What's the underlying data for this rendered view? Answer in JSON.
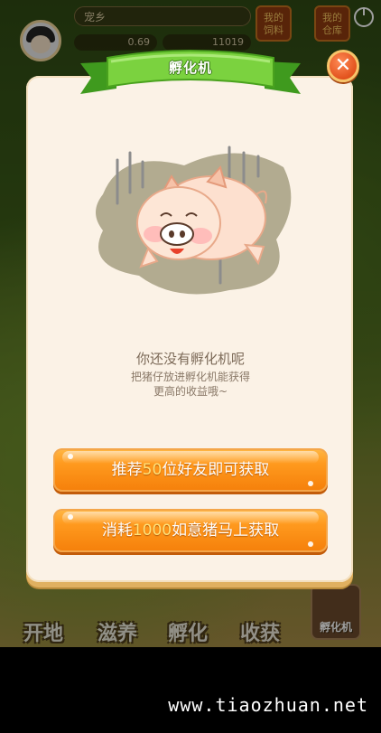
{
  "hud": {
    "name": "宠乡",
    "stat_1": "0.69",
    "stat_2": "11019",
    "button_1": "我的\n饲料",
    "button_2": "我的\n仓库"
  },
  "dialog": {
    "title": "孵化机",
    "close_icon": "close-x-icon",
    "message": "你还没有孵化机呢",
    "sub_line_1": "把猪仔放进孵化机能获得",
    "sub_line_2": "更高的收益哦~",
    "button_1": {
      "prefix": "推荐",
      "highlight": "50",
      "suffix": "位好友即可获取"
    },
    "button_2": {
      "prefix": "消耗",
      "highlight": "1000",
      "suffix": "如意猪马上获取"
    }
  },
  "bottom_bar": {
    "items": [
      "开地",
      "滋养",
      "孵化",
      "收获"
    ],
    "incubator_label": "孵化机"
  },
  "footer": {
    "watermark": "www.tiaozhuan.net"
  },
  "colors": {
    "accent_orange": "#f57f0a",
    "highlight_yellow": "#ffe27a",
    "ribbon_green": "#6cc33a",
    "close_red": "#e2521d",
    "panel_cream": "#fbf2e6"
  }
}
